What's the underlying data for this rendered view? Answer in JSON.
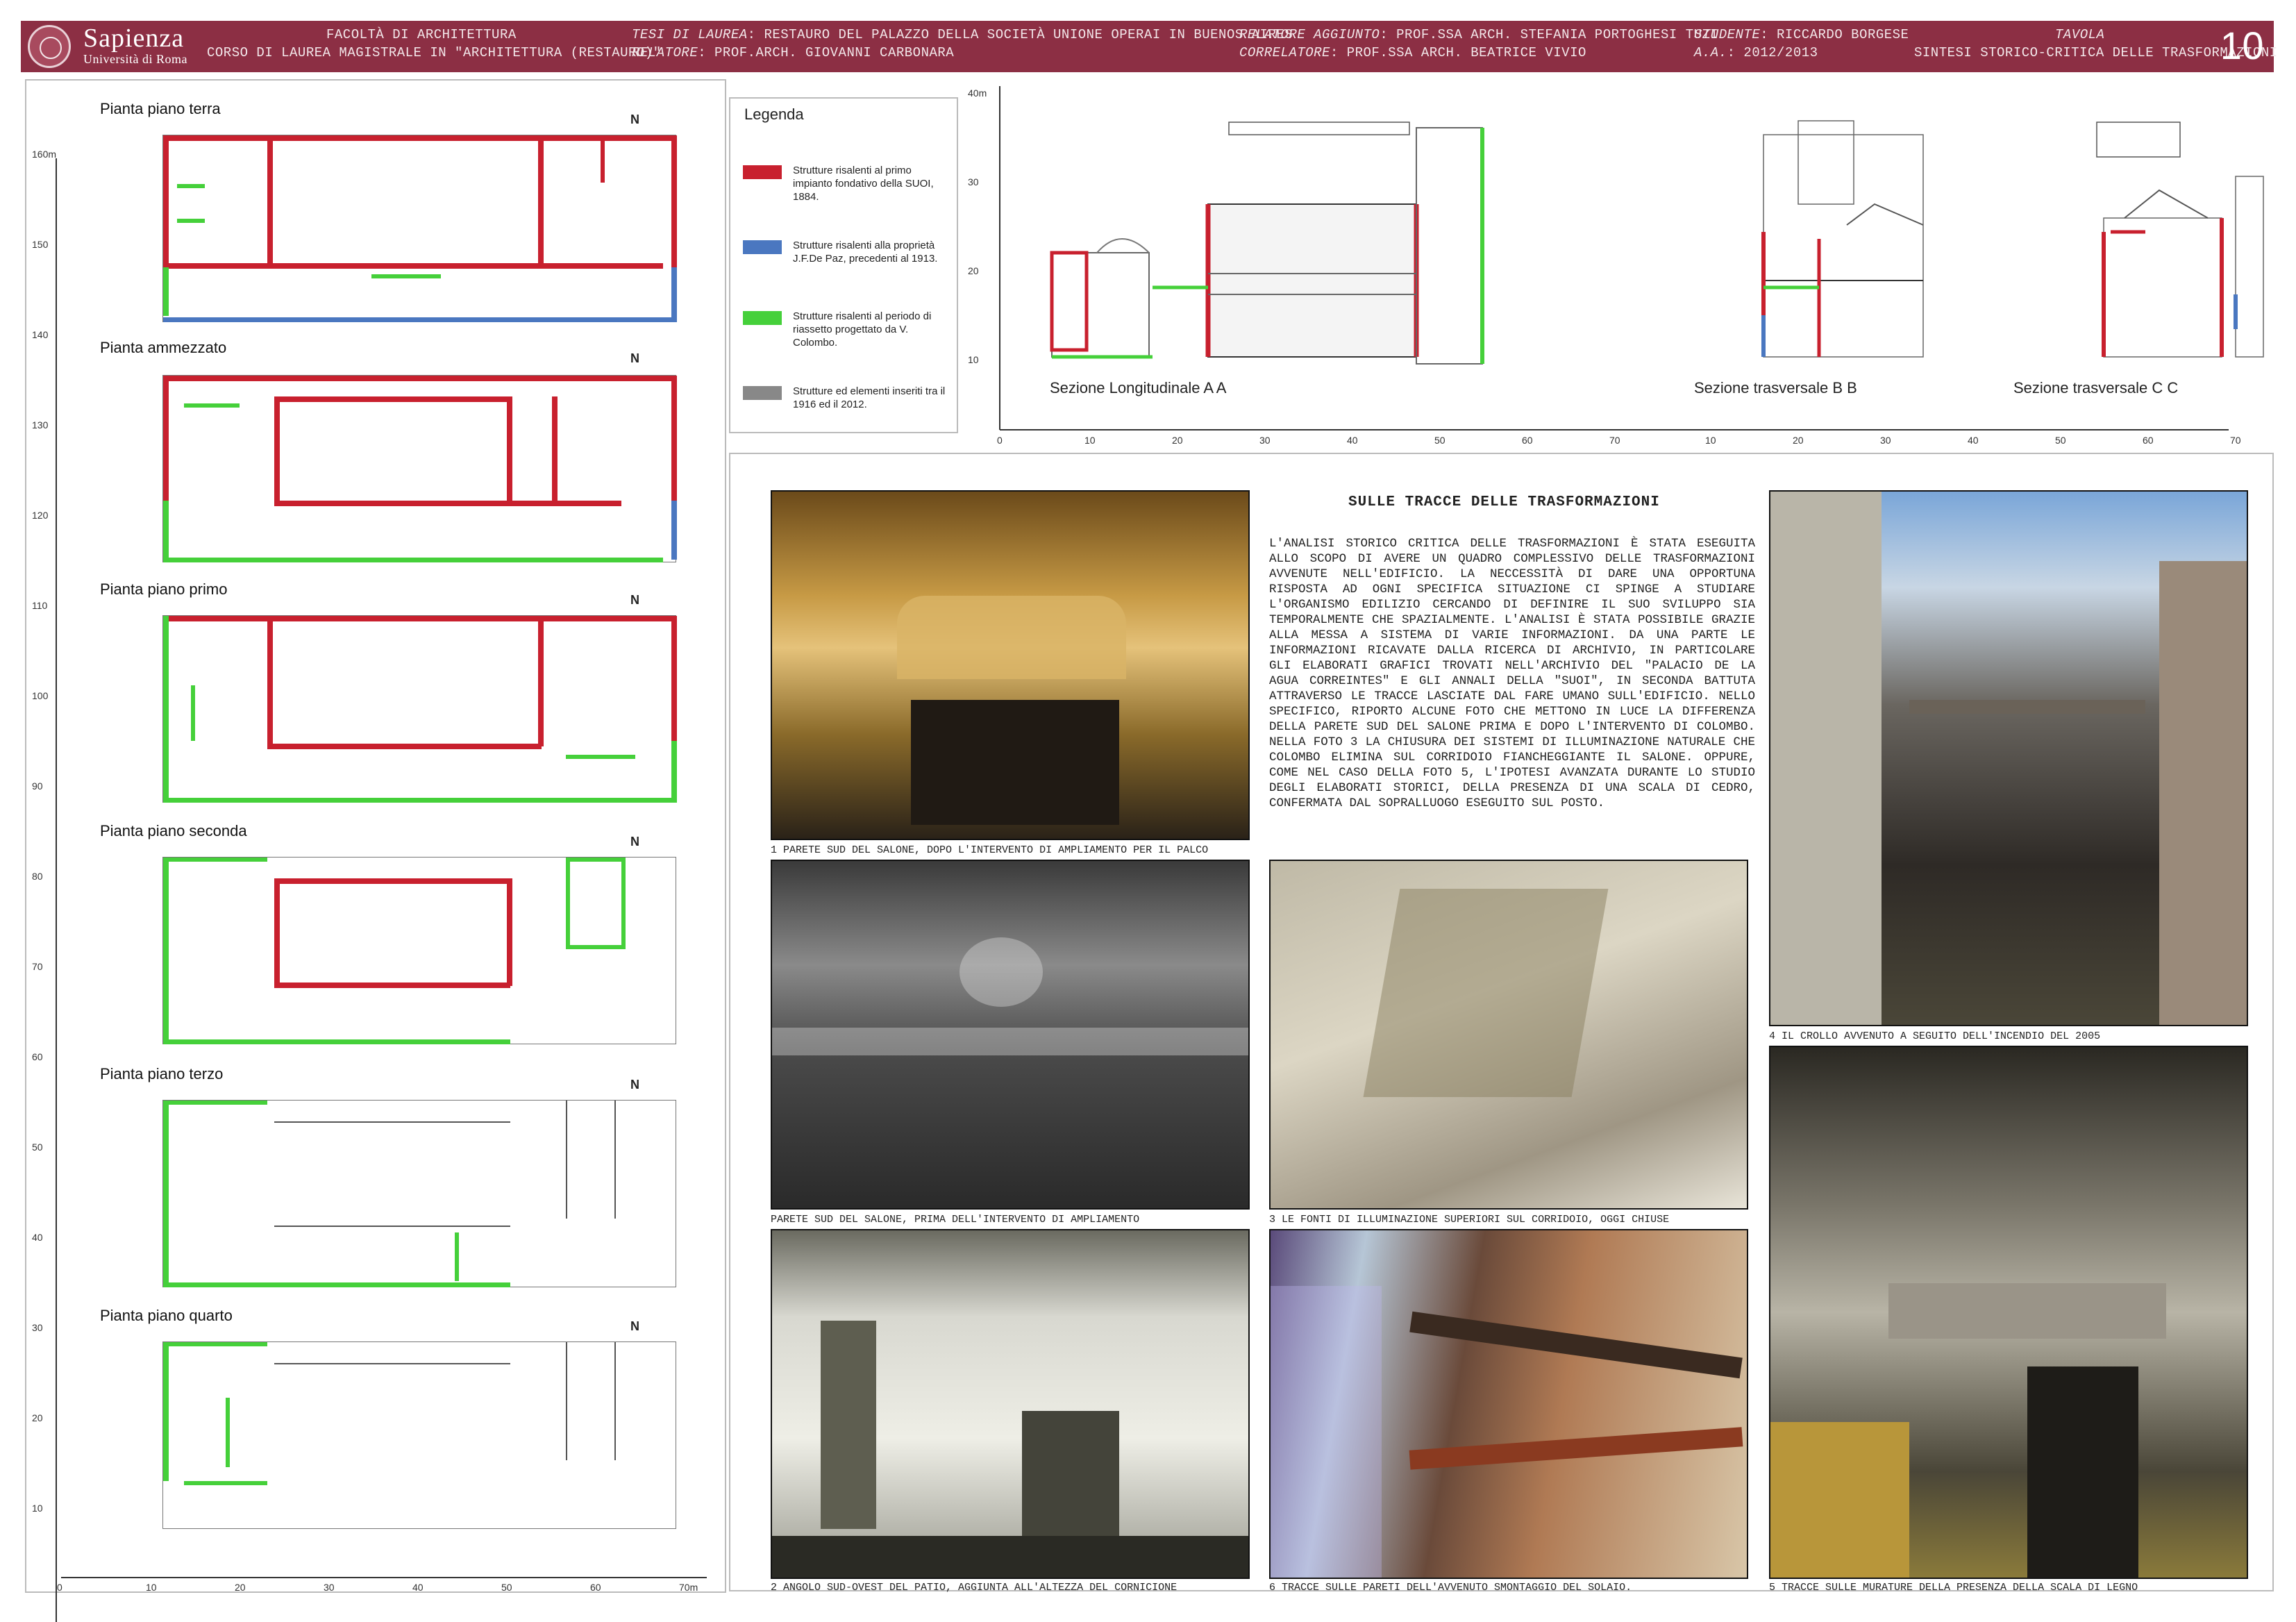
{
  "header": {
    "university_name": "Sapienza",
    "university_sub": "Università di Roma",
    "faculty": "FACOLTÀ DI ARCHITETTURA",
    "course": "CORSO DI LAUREA MAGISTRALE IN \"ARCHITETTURA (RESTAURO)\"",
    "thesis_label": "TESI DI LAUREA",
    "thesis_value": ": RESTAURO DEL PALAZZO DELLA SOCIETÀ UNIONE OPERAI IN BUENOS AIRES",
    "relatore_label": "RELATORE",
    "relatore_value": ": PROF.ARCH. GIOVANNI CARBONARA",
    "relatore_agg_label": "RELATORE AGGIUNTO",
    "relatore_agg_value": ": PROF.SSA ARCH. STEFANIA PORTOGHESI TUZI",
    "correlatore_label": "CORRELATORE",
    "correlatore_value": ": PROF.SSA ARCH. BEATRICE VIVIO",
    "studente_label": "STUDENTE",
    "studente_value": ": RICCARDO BORGESE",
    "aa_label": "A.A.",
    "aa_value": ": 2012/2013",
    "tavola_label": "TAVOLA",
    "tavola_value": "SINTESI STORICO-CRITICA DELLE TRASFORMAZIONI",
    "tavola_number": "10"
  },
  "plans": {
    "titles": [
      "Pianta piano terra",
      "Pianta ammezzato",
      "Pianta piano primo",
      "Pianta piano seconda",
      "Pianta piano terzo",
      "Pianta piano quarto"
    ],
    "north_label": "N",
    "vertical_ticks": [
      "160m",
      "150",
      "140",
      "130",
      "120",
      "110",
      "100",
      "90",
      "80",
      "70",
      "60",
      "50",
      "40",
      "30",
      "20",
      "10"
    ],
    "horizontal_ticks": [
      "0",
      "10",
      "20",
      "30",
      "40",
      "50",
      "60",
      "70m"
    ]
  },
  "legend": {
    "title": "Legenda",
    "items": [
      {
        "color": "#c8202e",
        "text": "Strutture risalenti al primo impianto fondativo della SUOI, 1884."
      },
      {
        "color": "#4a77c0",
        "text": "Strutture risalenti alla proprietà J.F.De Paz, precedenti al 1913."
      },
      {
        "color": "#45d03a",
        "text": "Strutture risalenti al periodo di riassetto progettato da V. Colombo."
      },
      {
        "color": "#888888",
        "text": "Strutture ed elementi inseriti tra il 1916 ed il 2012."
      }
    ]
  },
  "sections": {
    "labels": [
      "Sezione Longitudinale A A",
      "Sezione trasversale B B",
      "Sezione trasversale C C"
    ],
    "vertical_ticks": [
      "40m",
      "30",
      "20",
      "10"
    ],
    "horizontal_ticks": [
      "0",
      "10",
      "20",
      "30",
      "40",
      "50",
      "60",
      "70",
      "10",
      "20",
      "30",
      "40",
      "50",
      "60",
      "70"
    ]
  },
  "text_block": {
    "title": "SULLE TRACCE DELLE TRASFORMAZIONI",
    "body": "L'ANALISI STORICO CRITICA DELLE TRASFORMAZIONI È STATA ESEGUITA ALLO SCOPO DI AVERE UN QUADRO COMPLESSIVO DELLE TRASFORMAZIONI AVVENUTE NELL'EDIFICIO. LA NECCESSITÀ DI DARE UNA OPPORTUNA RISPOSTA AD OGNI SPECIFICA SITUAZIONE CI SPINGE A STUDIARE L'ORGANISMO EDILIZIO CERCANDO DI DEFINIRE IL SUO SVILUPPO SIA TEMPORALMENTE CHE SPAZIALMENTE. L'ANALISI È STATA POSSIBILE GRAZIE ALLA MESSA A SISTEMA DI VARIE INFORMAZIONI. DA UNA PARTE LE INFORMAZIONI RICAVATE DALLA RICERCA DI ARCHIVIO, IN PARTICOLARE GLI ELABORATI GRAFICI TROVATI NELL'ARCHIVIO DEL \"PALACIO DE LA AGUA CORREINTES\" E GLI ANNALI DELLA \"SUOI\", IN SECONDA BATTUTA ATTRAVERSO LE TRACCE LASCIATE DAL FARE UMANO SULL'EDIFICIO. NELLO SPECIFICO, RIPORTO ALCUNE FOTO CHE METTONO IN LUCE LA DIFFERENZA DELLA PARETE SUD DEL SALONE PRIMA E DOPO L'INTERVENTO DI COLOMBO. NELLA FOTO 3 LA CHIUSURA DEI SISTEMI DI ILLUMINAZIONE NATURALE CHE COLOMBO ELIMINA SUL CORRIDOIO FIANCHEGGIANTE IL SALONE. OPPURE, COME NEL CASO DELLA FOTO 5, L'IPOTESI AVANZATA DURANTE LO STUDIO DEGLI ELABORATI STORICI, DELLA PRESENZA DI UNA SCALA DI CEDRO, CONFERMATA DAL SOPRALLUOGO ESEGUITO SUL POSTO."
  },
  "photos": [
    {
      "caption": "1  PARETE SUD DEL SALONE, DOPO L'INTERVENTO DI AMPLIAMENTO PER IL PALCO",
      "tone": "warm"
    },
    {
      "caption": "PARETE SUD DEL SALONE, PRIMA DELL'INTERVENTO DI AMPLIAMENTO",
      "tone": "bw"
    },
    {
      "caption": "2 ANGOLO SUD-OVEST DEL PATIO, AGGIUNTA ALL'ALTEZZA DEL CORNICIONE",
      "tone": "light"
    },
    {
      "caption": "3 LE FONTI DI ILLUMINAZIONE SUPERIORI SUL CORRIDOIO, OGGI CHIUSE",
      "tone": "pale"
    },
    {
      "caption": "6 TRACCE SULLE PARETI DELL'AVVENUTO SMONTAGGIO DEL SOLAIO.",
      "tone": "rust"
    },
    {
      "caption": "4 IL CROLLO AVVENUTO A SEGUITO DELL'INCENDIO DEL 2005",
      "tone": "ruin"
    },
    {
      "caption": "5 TRACCE SULLE MURATURE DELLA PRESENZA DELLA SCALA DI LEGNO",
      "tone": "dark"
    }
  ]
}
